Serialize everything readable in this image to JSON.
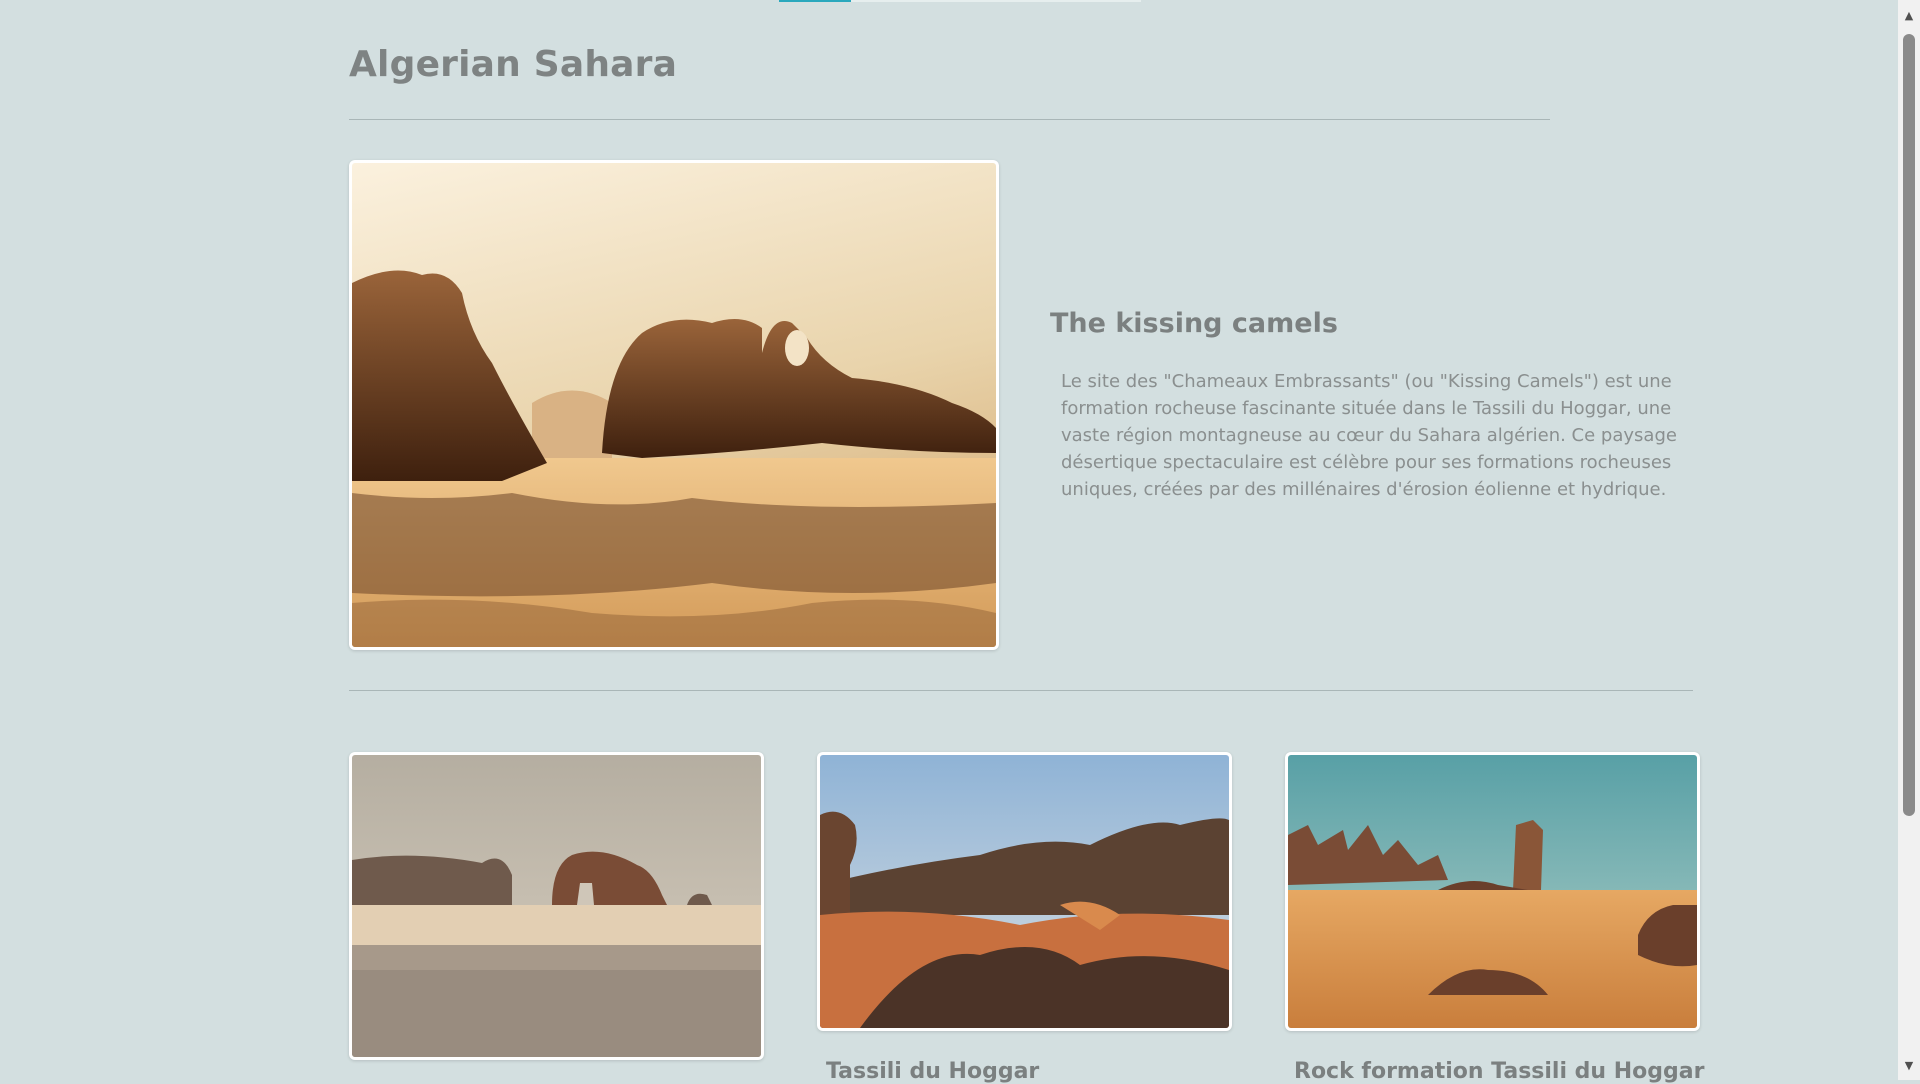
{
  "page": {
    "title": "Algerian Sahara",
    "reading_progress": 0.2
  },
  "feature": {
    "title": "The kissing camels",
    "description": "Le site des \"Chameaux Embrassants\" (ou \"Kissing Camels\") est une formation rocheuse fascinante située dans le Tassili du Hoggar, une vaste région montagneuse au cœur du Sahara algérien. Ce paysage désertique spectaculaire est célèbre pour ses formations rocheuses uniques, créées par des millénaires d'érosion éolienne et hydrique.",
    "image": "kissing-camels-rock-photo"
  },
  "gallery": [
    {
      "image": "elephant-rock-desert-photo",
      "caption": ""
    },
    {
      "image": "tassili-du-hoggar-photo",
      "caption": "Tassili du Hoggar"
    },
    {
      "image": "rock-formation-dunes-photo",
      "caption": "Rock formation Tassili du Hoggar"
    }
  ],
  "colors": {
    "background": "#d3dfe0",
    "accent": "#2aa8bd",
    "text": "#7c8181"
  },
  "scrollbar": {
    "up_icon": "arrow-up-icon",
    "down_icon": "arrow-down-icon"
  }
}
